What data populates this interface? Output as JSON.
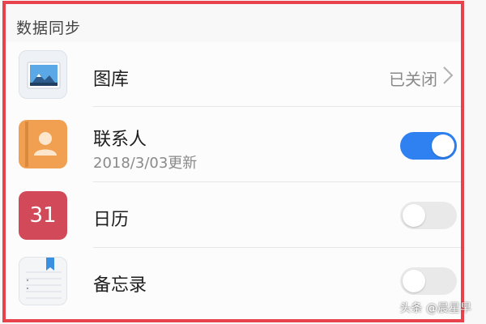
{
  "section": {
    "title": "数据同步"
  },
  "items": [
    {
      "title": "图库",
      "status": "已关闭",
      "icon": "gallery-icon"
    },
    {
      "title": "联系人",
      "subtitle": "2018/3/03更新",
      "toggle_on": true,
      "icon": "contacts-icon"
    },
    {
      "title": "日历",
      "icon_text": "31",
      "toggle_on": false,
      "icon": "calendar-icon"
    },
    {
      "title": "备忘录",
      "toggle_on": false,
      "icon": "notes-icon"
    }
  ],
  "watermark": "头条 @晨星早",
  "colors": {
    "accent": "#2f80f0",
    "frame": "#e8434c",
    "toggle_off": "#e9e9e9",
    "contacts_icon": "#f0a050",
    "calendar_icon": "#d24a5a"
  }
}
